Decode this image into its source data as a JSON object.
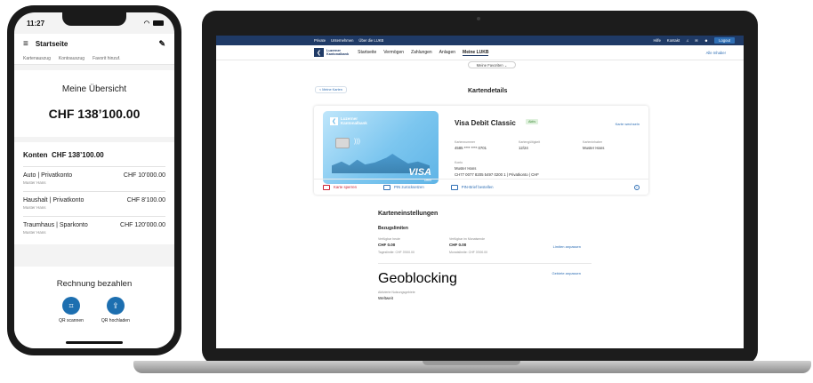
{
  "phone": {
    "status_time": "11:27",
    "header_title": "Startseite",
    "quick_links": [
      "Kartenauszug",
      "Kontoauszug",
      "Favorit hinzuf."
    ],
    "overview_title": "Meine Übersicht",
    "overview_total": "CHF 138’100.00",
    "accounts_title": "Konten",
    "accounts_total": "CHF 138’100.00",
    "accounts": [
      {
        "name": "Auto | Privatkonto",
        "owner": "Muster Hans",
        "amount": "CHF 10’000.00"
      },
      {
        "name": "Haushalt | Privatkonto",
        "owner": "Muster Hans",
        "amount": "CHF 8’100.00"
      },
      {
        "name": "Traumhaus | Sparkonto",
        "owner": "Muster Hans",
        "amount": "CHF 120’000.00"
      }
    ],
    "bill_title": "Rechnung bezahlen",
    "bill_scan_label": "QR scannen",
    "bill_upload_label": "QR hochladen",
    "accent_color": "#1d6fb0"
  },
  "laptop": {
    "topbar_left": [
      "Private",
      "Unternehmen",
      "Über die LUKB"
    ],
    "topbar_right": [
      "Hilfe",
      "Kontakt"
    ],
    "logout_label": "Logout",
    "brand_line1": "Luzerner",
    "brand_line2": "Kantonalbank",
    "nav_items": [
      "Startseite",
      "Vermögen",
      "Zahlungen",
      "Anlagen",
      "Meine LUKB"
    ],
    "nav_inbox": "Alle Inhaber",
    "favorites_label": "Meine Favoriten ⌄",
    "back_link": "< Meine Karten",
    "section_title": "Kartendetails",
    "card": {
      "name": "Visa Debit Classic",
      "status": "Aktiv",
      "change_link": "Karte wechseln",
      "fields": [
        {
          "label": "Kartennummer",
          "value": "4585 **** **** 0701"
        },
        {
          "label": "Kartengültigkeit",
          "value": "12/24"
        },
        {
          "label": "Karteninhaber",
          "value": "Muster Hans"
        }
      ],
      "konto_label": "Konto",
      "konto_owner": "Muster Hans",
      "konto_iban": "CH77 0077 8205 5497 0200 1 | Privatkonto | CHF",
      "brand_logo": "VISA",
      "brand_debit": "Debit",
      "card_bank_line1": "Luzerner",
      "card_bank_line2": "Kantonalbank",
      "actions": [
        "Karte sperren",
        "PIN zurücksetzen",
        "PIN-Brief bestellen"
      ]
    },
    "settings": {
      "title": "Karteneinstellungen",
      "limits_title": "Bezugslimiten",
      "limit_available_label": "Verfügbar heute",
      "limit_available_value": "CHF 0.00",
      "limit_daily": "Tageslimite: CHF 3'000.00",
      "limit_month_label": "Verfügbar im Monatsende",
      "limit_month_value": "CHF 0.00",
      "limit_monthly": "Monatslimite: CHF 3'000.00",
      "limit_link": "Limiten anpassen",
      "geo_title": "Geoblocking",
      "geo_label": "Aktivierte Nutzungsgebiete",
      "geo_value": "Weltweit",
      "geo_link": "Gebiete anpassen"
    },
    "accent_navy": "#1f3a66",
    "accent_blue": "#2f6fb5"
  }
}
